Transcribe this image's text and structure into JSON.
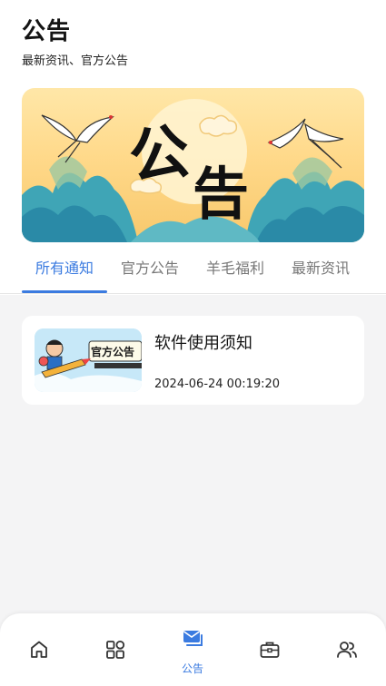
{
  "header": {
    "title": "公告",
    "subtitle": "最新资讯、官方公告"
  },
  "banner": {
    "art_text": [
      "公",
      "告"
    ]
  },
  "tabs": [
    {
      "label": "所有通知",
      "active": true
    },
    {
      "label": "官方公告",
      "active": false
    },
    {
      "label": "羊毛福利",
      "active": false
    },
    {
      "label": "最新资讯",
      "active": false
    }
  ],
  "notices": [
    {
      "title": "软件使用须知",
      "time": "2024-06-24 00:19:20",
      "thumb_text": "官方公告"
    }
  ],
  "bottom_nav": [
    {
      "icon": "home-icon",
      "label": ""
    },
    {
      "icon": "grid-icon",
      "label": ""
    },
    {
      "icon": "message-icon",
      "label": "公告",
      "active": true
    },
    {
      "icon": "toolbox-icon",
      "label": ""
    },
    {
      "icon": "users-icon",
      "label": ""
    }
  ],
  "colors": {
    "accent": "#3b7be0",
    "background": "#f4f4f5"
  }
}
